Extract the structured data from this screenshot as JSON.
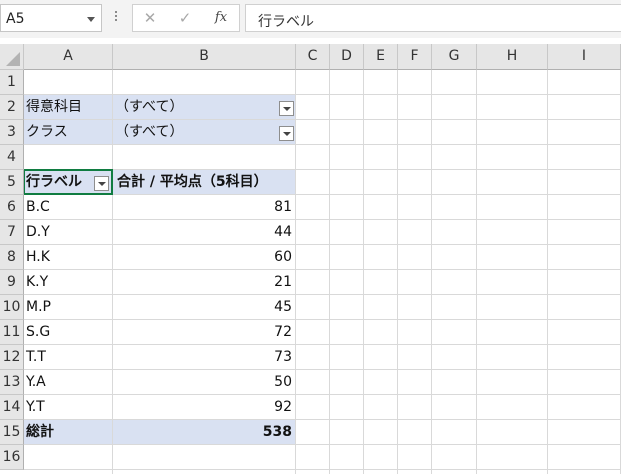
{
  "formula_bar": {
    "name_box": "A5",
    "cancel_glyph": "✕",
    "enter_glyph": "✓",
    "fx_label": "fx",
    "formula": "行ラベル"
  },
  "columns": [
    "A",
    "B",
    "C",
    "D",
    "E",
    "F",
    "G",
    "H",
    "I"
  ],
  "rows": [
    "1",
    "2",
    "3",
    "4",
    "5",
    "6",
    "7",
    "8",
    "9",
    "10",
    "11",
    "12",
    "13",
    "14",
    "15",
    "16"
  ],
  "pivot": {
    "filters": [
      {
        "label": "得意科目",
        "value": "（すべて）"
      },
      {
        "label": "クラス",
        "value": "（すべて）"
      }
    ],
    "header": {
      "row_label": "行ラベル",
      "value_label": "合計 / 平均点（5科目）"
    },
    "items": [
      {
        "name": "B.C",
        "value": "81"
      },
      {
        "name": "D.Y",
        "value": "44"
      },
      {
        "name": "H.K",
        "value": "60"
      },
      {
        "name": "K.Y",
        "value": "21"
      },
      {
        "name": "M.P",
        "value": "45"
      },
      {
        "name": "S.G",
        "value": "72"
      },
      {
        "name": "T.T",
        "value": "73"
      },
      {
        "name": "Y.A",
        "value": "50"
      },
      {
        "name": "Y.T",
        "value": "92"
      }
    ],
    "total": {
      "label": "総計",
      "value": "538"
    }
  },
  "colors": {
    "pivot_band": "#d9e1f2",
    "selection": "#107c41",
    "header_bg": "#e6e6e6"
  }
}
